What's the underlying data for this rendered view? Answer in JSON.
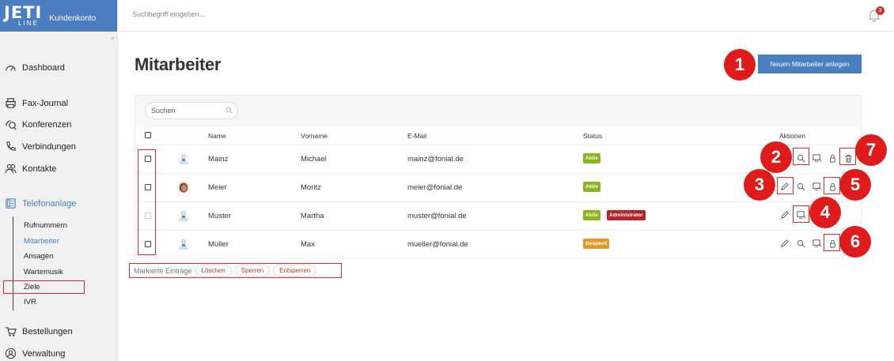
{
  "brand": {
    "logo": "JETI",
    "logo_sub": "LINE",
    "subtitle": "Kundenkonto"
  },
  "topbar": {
    "search_placeholder": "Suchbegriff eingeben...",
    "notification_count": "3"
  },
  "sidebar": {
    "items": [
      {
        "label": "Dashboard",
        "icon": "dashboard-icon"
      },
      {
        "label": "Fax-Journal",
        "icon": "fax-icon"
      },
      {
        "label": "Konferenzen",
        "icon": "conference-icon"
      },
      {
        "label": "Verbindungen",
        "icon": "phone-icon"
      },
      {
        "label": "Kontakte",
        "icon": "contacts-icon"
      },
      {
        "label": "Telefonanlage",
        "icon": "pbx-icon",
        "active": true
      },
      {
        "label": "Bestellungen",
        "icon": "cart-icon"
      },
      {
        "label": "Verwaltung",
        "icon": "user-circle-icon"
      }
    ],
    "subitems": [
      {
        "label": "Rufnummern"
      },
      {
        "label": "Mitarbeiter",
        "active": true
      },
      {
        "label": "Ansagen"
      },
      {
        "label": "Wartemusik"
      },
      {
        "label": "Ziele"
      },
      {
        "label": "IVR"
      }
    ]
  },
  "page": {
    "title": "Mitarbeiter",
    "new_button": "Neuen Mitarbeiter anlegen"
  },
  "table": {
    "search_label": "Suchen",
    "headers": {
      "name": "Name",
      "vorname": "Vorname",
      "email": "E-Mail",
      "status": "Status",
      "aktionen": "Aktionen"
    },
    "rows": [
      {
        "name": "Mainz",
        "vorname": "Michael",
        "email": "mainz@fonial.de",
        "status": [
          "Aktiv"
        ]
      },
      {
        "name": "Meier",
        "vorname": "Moritz",
        "email": "meier@fonial.de",
        "status": [
          "Aktiv"
        ]
      },
      {
        "name": "Muster",
        "vorname": "Martha",
        "email": "muster@fonial.de",
        "status": [
          "Aktiv",
          "Administrator"
        ]
      },
      {
        "name": "Müller",
        "vorname": "Max",
        "email": "mueller@fonial.de",
        "status": [
          "Gesperrt"
        ]
      }
    ]
  },
  "bulk": {
    "label": "Markierte Einträge",
    "delete": "Löschen",
    "lock": "Sperren",
    "unlock": "Entsperren"
  },
  "callouts": [
    "1",
    "2",
    "3",
    "4",
    "5",
    "6",
    "7"
  ],
  "colors": {
    "accent": "#4a7ec1",
    "callout": "#e01b1b",
    "aktiv": "#8bb51f",
    "admin": "#b0262b",
    "gesperrt": "#e09a2c"
  }
}
